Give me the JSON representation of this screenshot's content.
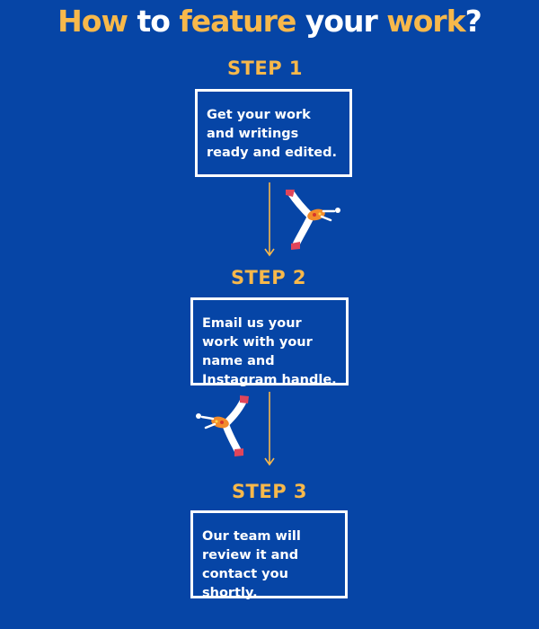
{
  "title": {
    "part1": "How",
    "part2": " to ",
    "part3": "feature",
    "part4": " your ",
    "part5": "work",
    "part6": "?"
  },
  "steps": [
    {
      "label": "STEP 1",
      "text": "Get your work and writings ready and edited."
    },
    {
      "label": "STEP 2",
      "text": "Email us your work with your name and Instagram handle."
    },
    {
      "label": "STEP 3",
      "text": "Our team will review it and contact you shortly."
    }
  ],
  "colors": {
    "background": "#0645a6",
    "accent": "#f7b84b",
    "text": "#ffffff",
    "arrow": "#f7b84b"
  },
  "illustrations": [
    "dancer-figure",
    "dancer-figure"
  ]
}
